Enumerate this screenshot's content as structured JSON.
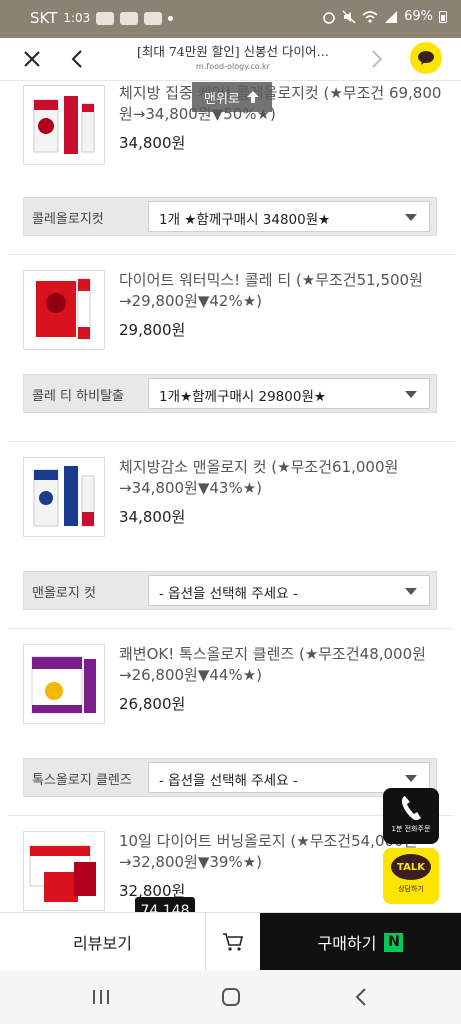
{
  "status_bar": {
    "carrier": "SKT",
    "time": "1:03",
    "battery": "69%"
  },
  "browser": {
    "title": "[최대 74만원 할인] 신봉선 다이어…",
    "url": "m.food-ology.co.kr"
  },
  "scroll_top_label": "맨위로",
  "products": [
    {
      "name": "체지방 집중 케어! 콜레올로지컷 (★무조건 69,800원→34,800원▼50%★)",
      "price": "34,800원",
      "option_label": "콜레올로지컷",
      "option_value": "1개 ★함께구매시 34800원★"
    },
    {
      "name": "다이어트 워터믹스! 콜레 티 (★무조건51,500원→29,800원▼42%★)",
      "price": "29,800원",
      "option_label": "콜레 티 하비탈출",
      "option_value": "1개★함께구매시 29800원★"
    },
    {
      "name": "체지방감소 맨올로지 컷 (★무조건61,000원→34,800원▼43%★)",
      "price": "34,800원",
      "option_label": "맨올로지 컷",
      "option_value": "- 옵션을 선택해 주세요 -"
    },
    {
      "name": "쾌변OK! 톡스올로지 클렌즈 (★무조건48,000원→26,800원▼44%★)",
      "price": "26,800원",
      "option_label": "톡스올로지 클렌즈",
      "option_value": "- 옵션을 선택해 주세요 -"
    },
    {
      "name": "10일 다이어트 버닝올로지 (★무조건54,000원→32,800원▼39%★)",
      "price": "32,800원"
    }
  ],
  "floating": {
    "call_label": "1분 전화주문",
    "talk_title": "TALK",
    "talk_label": "상담하기"
  },
  "review_count": "74,148",
  "bottom_bar": {
    "review_label": "리뷰보기",
    "buy_label": "구매하기",
    "npay_mark": "N"
  },
  "colors": {
    "accent_dark": "#111111",
    "kakao_yellow": "#fee500",
    "naver_green": "#03c75a",
    "status_bar": "#8c8273"
  },
  "icons": [
    "close-icon",
    "back-arrow-icon",
    "forward-arrow-icon",
    "kakao-chat-icon",
    "up-arrow-icon",
    "phone-icon",
    "cart-icon",
    "recent-apps-icon",
    "home-icon",
    "nav-back-icon"
  ]
}
